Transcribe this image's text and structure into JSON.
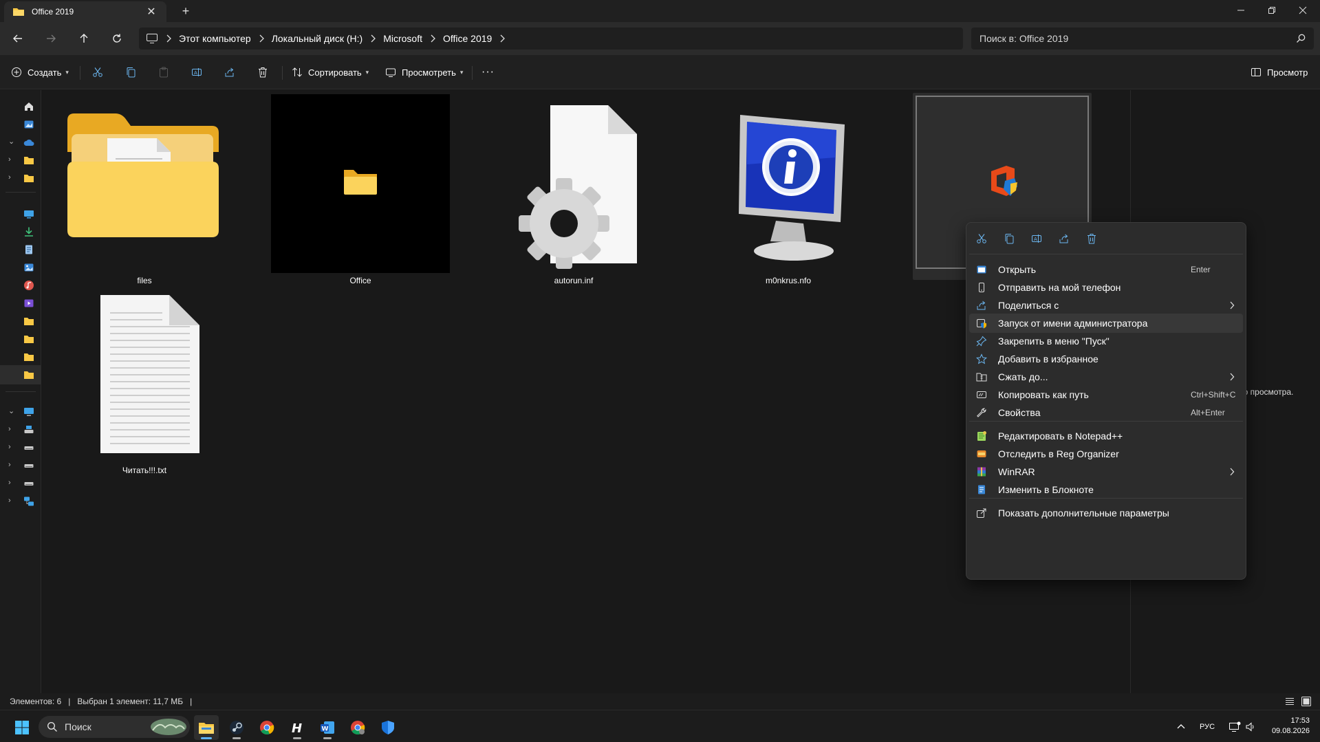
{
  "window": {
    "tab_title": "Office 2019",
    "new_tab": "+",
    "close_tab": "✕"
  },
  "address": {
    "crumbs": [
      "Этот компьютер",
      "Локальный диск (H:)",
      "Microsoft",
      "Office 2019"
    ],
    "search_placeholder": "Поиск в: Office 2019"
  },
  "toolbar": {
    "create": "Создать",
    "sort": "Сортировать",
    "view": "Просмотреть",
    "more": "···",
    "preview": "Просмотр"
  },
  "files": [
    {
      "name": "files",
      "icon": "folder-with-document-icon"
    },
    {
      "name": "Office",
      "icon": "folder-small-icon"
    },
    {
      "name": "autorun.inf",
      "icon": "settings-file-icon"
    },
    {
      "name": "m0nkrus.nfo",
      "icon": "info-monitor-icon"
    },
    {
      "name": "",
      "icon": "office-setup-icon"
    },
    {
      "name": "Читать!!!.txt",
      "icon": "text-file-icon"
    }
  ],
  "preview_pane": {
    "message": "ьного просмотра."
  },
  "context_menu": {
    "quick_actions": [
      "cut-icon",
      "copy-icon",
      "rename-icon",
      "share-icon",
      "delete-icon"
    ],
    "items": [
      {
        "label": "Открыть",
        "shortcut": "Enter",
        "icon": "open-icon"
      },
      {
        "label": "Отправить на мой телефон",
        "shortcut": "",
        "icon": "phone-icon"
      },
      {
        "label": "Поделиться с",
        "shortcut": "",
        "icon": "share-with-icon",
        "submenu": true
      },
      {
        "label": "Запуск от имени администратора",
        "shortcut": "",
        "icon": "admin-shield-icon",
        "highlighted": true
      },
      {
        "label": "Закрепить в меню \"Пуск\"",
        "shortcut": "",
        "icon": "pin-icon"
      },
      {
        "label": "Добавить в избранное",
        "shortcut": "",
        "icon": "star-icon"
      },
      {
        "label": "Сжать до...",
        "shortcut": "",
        "icon": "compress-icon",
        "submenu": true
      },
      {
        "label": "Копировать как путь",
        "shortcut": "Ctrl+Shift+C",
        "icon": "copy-path-icon"
      },
      {
        "label": "Свойства",
        "shortcut": "Alt+Enter",
        "icon": "wrench-icon"
      },
      {
        "label": "Редактировать в Notepad++",
        "shortcut": "",
        "icon": "notepadpp-icon"
      },
      {
        "label": "Отследить в Reg Organizer",
        "shortcut": "",
        "icon": "reg-organizer-icon"
      },
      {
        "label": "WinRAR",
        "shortcut": "",
        "icon": "winrar-icon",
        "submenu": true
      },
      {
        "label": "Изменить в Блокноте",
        "shortcut": "",
        "icon": "notepad-icon"
      },
      {
        "label": "Показать дополнительные параметры",
        "shortcut": "",
        "icon": "more-options-icon"
      }
    ]
  },
  "status": {
    "items_count": "Элементов: 6",
    "selected": "Выбран 1 элемент: 11,7 МБ"
  },
  "taskbar": {
    "search_placeholder": "Поиск",
    "language": "РУС",
    "time": "17:53",
    "date": "09.08.2026"
  },
  "colors": {
    "background": "#191919",
    "accent": "#5fb2f5",
    "folder": "#f8c845",
    "highlight": "#383838"
  }
}
